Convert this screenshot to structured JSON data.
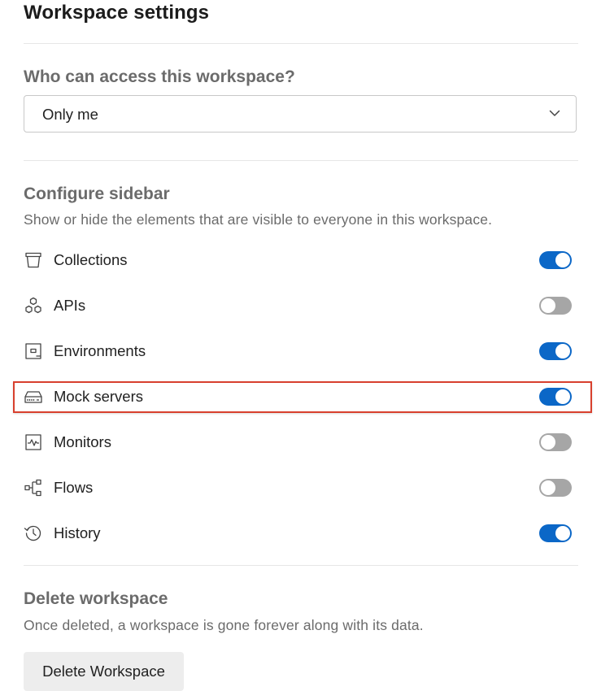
{
  "page": {
    "title": "Workspace settings"
  },
  "access": {
    "heading": "Who can access this workspace?",
    "selected": "Only me"
  },
  "sidebar_config": {
    "heading": "Configure sidebar",
    "description": "Show or hide the elements that are visible to everyone in this workspace.",
    "items": [
      {
        "label": "Collections",
        "icon": "collections-icon",
        "enabled": true
      },
      {
        "label": "APIs",
        "icon": "apis-icon",
        "enabled": false
      },
      {
        "label": "Environments",
        "icon": "environments-icon",
        "enabled": true
      },
      {
        "label": "Mock servers",
        "icon": "mock-servers-icon",
        "enabled": true
      },
      {
        "label": "Monitors",
        "icon": "monitors-icon",
        "enabled": false
      },
      {
        "label": "Flows",
        "icon": "flows-icon",
        "enabled": false
      },
      {
        "label": "History",
        "icon": "history-icon",
        "enabled": true
      }
    ]
  },
  "delete": {
    "heading": "Delete workspace",
    "description": "Once deleted, a workspace is gone forever along with its data.",
    "button_label": "Delete Workspace"
  },
  "colors": {
    "toggle_on": "#0b67c7",
    "toggle_off": "#a6a6a6",
    "highlight": "#d8402e"
  }
}
